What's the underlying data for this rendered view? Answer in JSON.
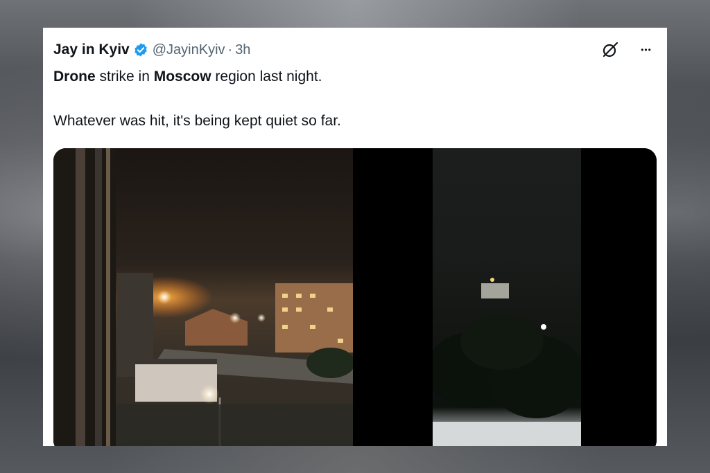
{
  "tweet": {
    "author_name": "Jay in Kyiv",
    "handle": "@JayinKyiv",
    "separator": "·",
    "time": "3h",
    "line1": [
      {
        "text": "Drone",
        "bold": true
      },
      {
        "text": " strike in ",
        "bold": false
      },
      {
        "text": "Moscow",
        "bold": true
      },
      {
        "text": " region last night.",
        "bold": false
      }
    ],
    "line2": "Whatever was hit, it's being kept quiet so far.",
    "icons": {
      "verified": "verified-badge-icon",
      "grok": "grok-icon",
      "more": "more-icon"
    },
    "more_glyph": "•••"
  },
  "colors": {
    "accent": "#1d9bf0",
    "text": "#0f1419",
    "muted": "#536471"
  }
}
